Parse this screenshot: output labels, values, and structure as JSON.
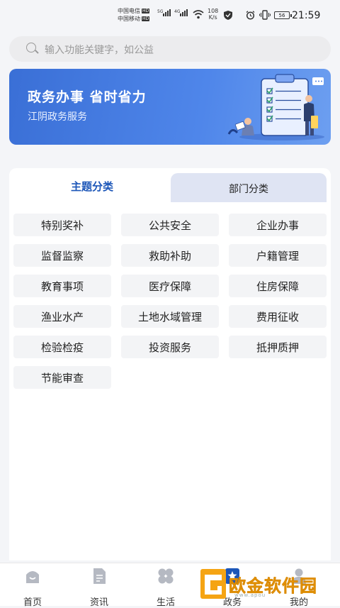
{
  "status_bar": {
    "carrier1": "中国电信",
    "carrier2": "中国移动",
    "hd_badge": "HD",
    "net1": "5G",
    "net2": "4G",
    "speed_value": "108",
    "speed_unit": "K/s",
    "battery": "56",
    "time": "21:59"
  },
  "search": {
    "placeholder": "输入功能关键字，如公益"
  },
  "banner": {
    "title": "政务办事 省时省力",
    "subtitle": "江阴政务服务"
  },
  "tabs": [
    {
      "label": "主题分类",
      "active": true
    },
    {
      "label": "部门分类",
      "active": false
    }
  ],
  "categories": [
    "特别奖补",
    "公共安全",
    "企业办事",
    "监督监察",
    "救助补助",
    "户籍管理",
    "教育事项",
    "医疗保障",
    "住房保障",
    "渔业水产",
    "土地水域管理",
    "费用征收",
    "检验检疫",
    "投资服务",
    "抵押质押",
    "节能审查"
  ],
  "nav": [
    {
      "label": "首页",
      "icon": "home-icon"
    },
    {
      "label": "资讯",
      "icon": "news-icon"
    },
    {
      "label": "生活",
      "icon": "life-icon"
    },
    {
      "label": "政务",
      "icon": "government-icon"
    },
    {
      "label": "我的",
      "icon": "profile-icon"
    }
  ],
  "watermark": {
    "text": "欧金软件园",
    "url": "www.apou"
  },
  "colors": {
    "accent": "#1c56b8",
    "banner": "#4a80e6",
    "tab_inactive": "#dfe4f3"
  }
}
